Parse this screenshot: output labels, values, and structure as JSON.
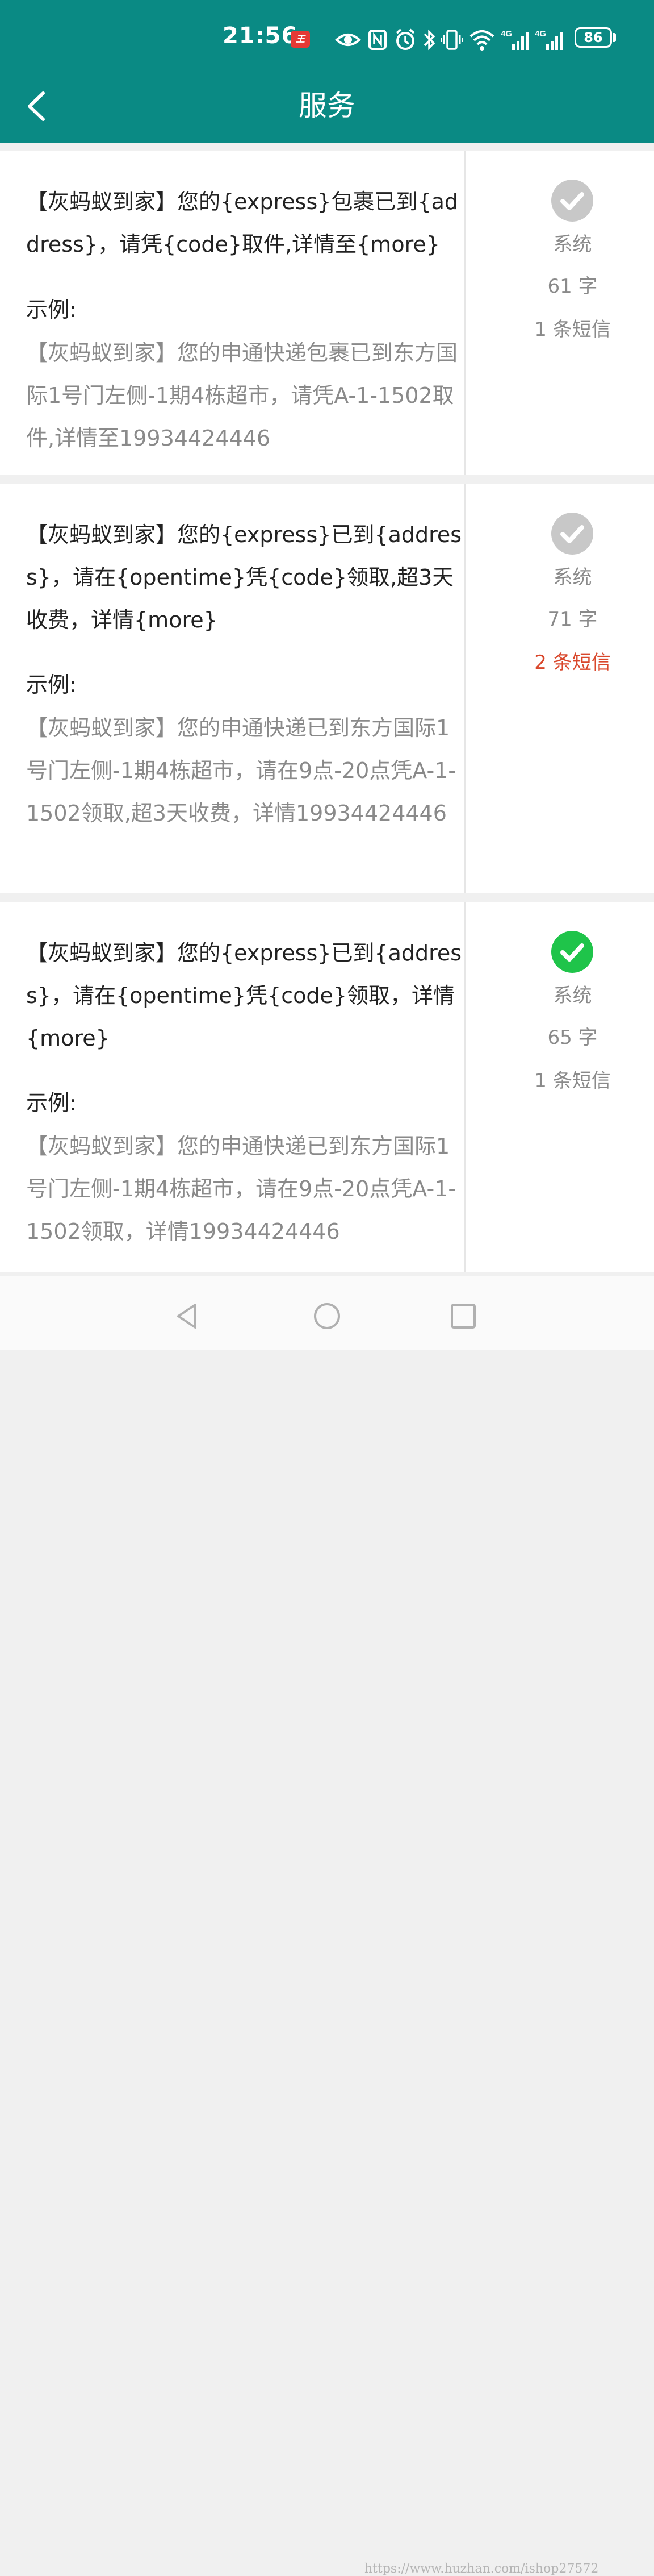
{
  "status_bar": {
    "time": "21:56",
    "notification_badge": "王",
    "battery": "86"
  },
  "header": {
    "title": "服务",
    "background": "#0a8a84"
  },
  "cards": [
    {
      "template": "【灰蚂蚁到家】您的{express}包裹已到{address}，请凭{code}取件,详情至{more}",
      "example_label": "示例:",
      "example": "【灰蚂蚁到家】您的申通快递包裹已到东方国际1号门左侧-1期4栋超市，请凭A-1-1502取件,详情至19934424446",
      "source": "系统",
      "chars": "61 字",
      "sms": "1 条短信",
      "selected": false
    },
    {
      "template": "【灰蚂蚁到家】您的{express}已到{address}，请在{opentime}凭{code}领取,超3天收费，详情{more}",
      "example_label": "示例:",
      "example": "【灰蚂蚁到家】您的申通快递已到东方国际1号门左侧-1期4栋超市，请在9点-20点凭A-1-1502领取,超3天收费，详情19934424446",
      "source": "系统",
      "chars": "71 字",
      "sms": "2 条短信",
      "selected": false
    },
    {
      "template": "【灰蚂蚁到家】您的{express}已到{address}，请在{opentime}凭{code}领取，详情{more}",
      "example_label": "示例:",
      "example": "【灰蚂蚁到家】您的申通快递已到东方国际1号门左侧-1期4栋超市，请在9点-20点凭A-1-1502领取，详情19934424446",
      "source": "系统",
      "chars": "65 字",
      "sms": "1 条短信",
      "selected": true
    }
  ],
  "colors": {
    "check_selected": "#1fc44a",
    "check_unselected": "#c8c8c8",
    "warn": "#d9472b"
  },
  "watermark": "https://www.huzhan.com/ishop27572"
}
